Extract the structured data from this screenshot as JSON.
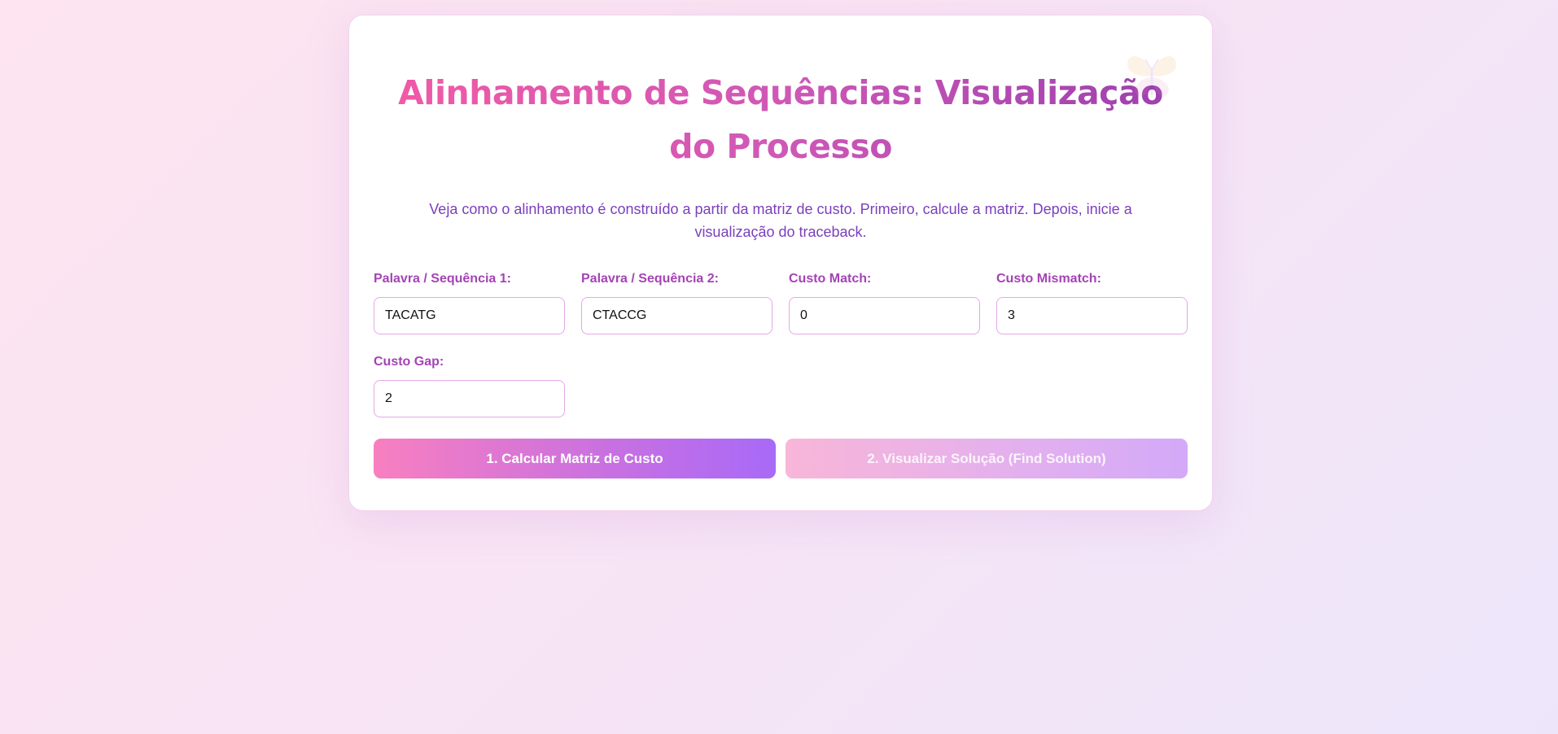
{
  "header": {
    "title": "Alinhamento de Sequências: Visualização do Processo",
    "subtitle": "Veja como o alinhamento é construído a partir da matriz de custo. Primeiro, calcule a matriz. Depois, inicie a visualização do traceback.",
    "decoration_icon": "butterfly-icon"
  },
  "form": {
    "seq1": {
      "label": "Palavra / Sequência 1:",
      "value": "TACATG"
    },
    "seq2": {
      "label": "Palavra / Sequência 2:",
      "value": "CTACCG"
    },
    "match": {
      "label": "Custo Match:",
      "value": "0"
    },
    "mismatch": {
      "label": "Custo Mismatch:",
      "value": "3"
    },
    "gap": {
      "label": "Custo Gap:",
      "value": "2"
    }
  },
  "actions": {
    "calculate_label": "1. Calcular Matriz de Custo",
    "visualize_label": "2. Visualizar Solução (Find Solution)",
    "visualize_disabled": true
  },
  "colors": {
    "title_gradient_start": "#f25aa5",
    "title_gradient_end": "#9b3fae",
    "label": "#a443b5",
    "subtitle": "#7a3fbd",
    "input_border": "#e4a8e6",
    "primary_button_start": "#f87fc0",
    "primary_button_end": "#a86af7"
  }
}
